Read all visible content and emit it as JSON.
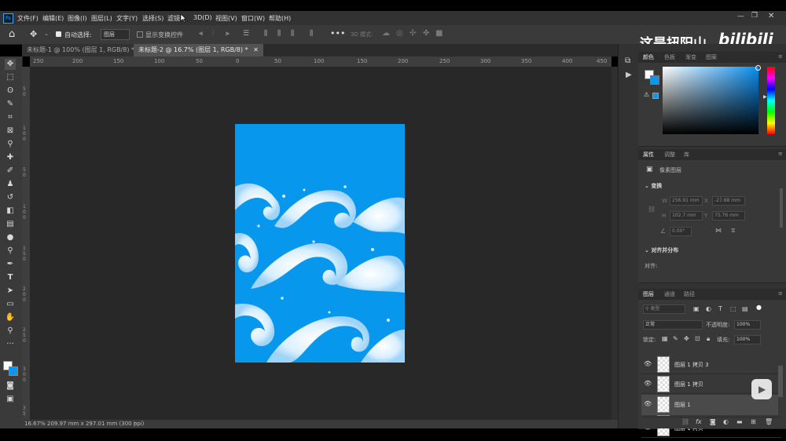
{
  "menubar": {
    "app_icon": "Ps",
    "items": [
      "文件(F)",
      "编辑(E)",
      "图像(I)",
      "图层(L)",
      "文字(Y)",
      "选择(S)",
      "滤镜",
      "3D(D)",
      "视图(V)",
      "窗口(W)",
      "帮助(H)"
    ]
  },
  "options": {
    "auto_select_label": "自动选择:",
    "auto_select_value": "图层",
    "show_transform_label": "显示变换控件",
    "mode_3d_label": "3D 模式:"
  },
  "tabs": [
    {
      "label": "未标题-1 @ 100% (图层 1, RGB/8) *"
    },
    {
      "label": "未标题-2 @ 16.7% (图层 1, RGB/8) *"
    }
  ],
  "ruler_top": [
    "250",
    "200",
    "150",
    "100",
    "50",
    "0",
    "50",
    "100",
    "150",
    "200",
    "250",
    "300",
    "350",
    "400",
    "450"
  ],
  "ruler_left": [
    "5\n0",
    "1\n0\n0",
    "5\n0",
    "1\n0\n0",
    "1\n5\n0",
    "2\n0\n0",
    "2\n5\n0",
    "3\n0\n0",
    "3\n5"
  ],
  "status": {
    "zoom": "16.67%",
    "doc_info": "209.97 mm x 297.01 mm (300 ppi)"
  },
  "watermark": {
    "text": "这是扭阳山",
    "brand": "bilibili"
  },
  "color_panel": {
    "tabs": [
      "颜色",
      "色板",
      "渐变",
      "图案"
    ],
    "fg": "#ffffff",
    "bg": "#0798ee"
  },
  "properties_panel": {
    "tabs": [
      "属性",
      "调整",
      "库"
    ],
    "layer_type": "像素图层",
    "transform_title": "变换",
    "w_label": "W",
    "w_value": "256.91 mm",
    "x_label": "X",
    "x_value": "-27.68 mm",
    "h_label": "H",
    "h_value": "102.7 mm",
    "y_label": "Y",
    "y_value": "75.76 mm",
    "angle_value": "0.00°",
    "align_title": "对齐并分布",
    "align_label": "对齐:"
  },
  "layers_panel": {
    "tabs": [
      "图层",
      "通道",
      "路径"
    ],
    "filter_label": "类型",
    "blend_mode": "正常",
    "opacity_label": "不透明度:",
    "opacity_value": "100%",
    "lock_label": "锁定:",
    "fill_label": "填充:",
    "fill_value": "100%",
    "layers": [
      {
        "name": "图层 1 拷贝 3",
        "selected": false
      },
      {
        "name": "图层 1 拷贝",
        "selected": false
      },
      {
        "name": "图层 1",
        "selected": true
      }
    ]
  },
  "colors": {
    "accent": "#0798ee",
    "wave": "#eaf6ff"
  }
}
